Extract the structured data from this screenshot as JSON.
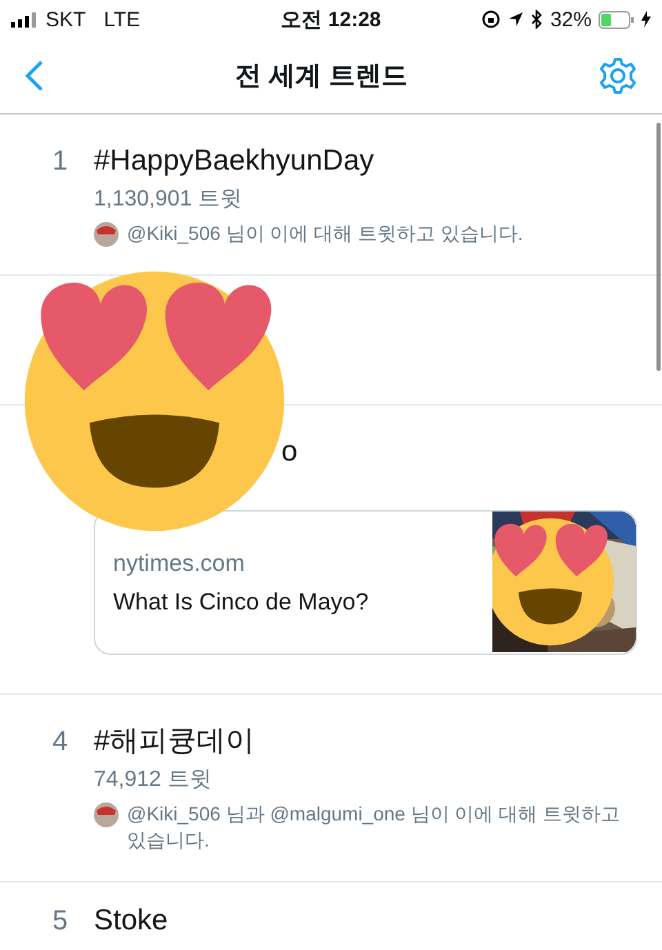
{
  "status_bar": {
    "carrier": "SKT",
    "network": "LTE",
    "time": "오전 12:28",
    "battery": "32%"
  },
  "nav": {
    "title": "전 세계 트렌드"
  },
  "trends": [
    {
      "kind": "full",
      "rank": "1",
      "title": "#HappyBaekhyunDay",
      "count": "1,130,901 트윗",
      "note": "@Kiki_506 님이 이에 대해 트윗하고 있습니다."
    },
    {
      "kind": "hidden"
    },
    {
      "kind": "covered",
      "title": "o",
      "card": {
        "domain": "nytimes.com",
        "headline": "What Is Cinco de Mayo?"
      }
    },
    {
      "kind": "full",
      "rank": "4",
      "title": "#해피큥데이",
      "count": "74,912 트윗",
      "note": "@Kiki_506 님과 @malgumi_one 님이 이에 대해 트윗하고 있습니다."
    },
    {
      "kind": "title_only",
      "rank": "5",
      "title": "Stoke"
    }
  ]
}
